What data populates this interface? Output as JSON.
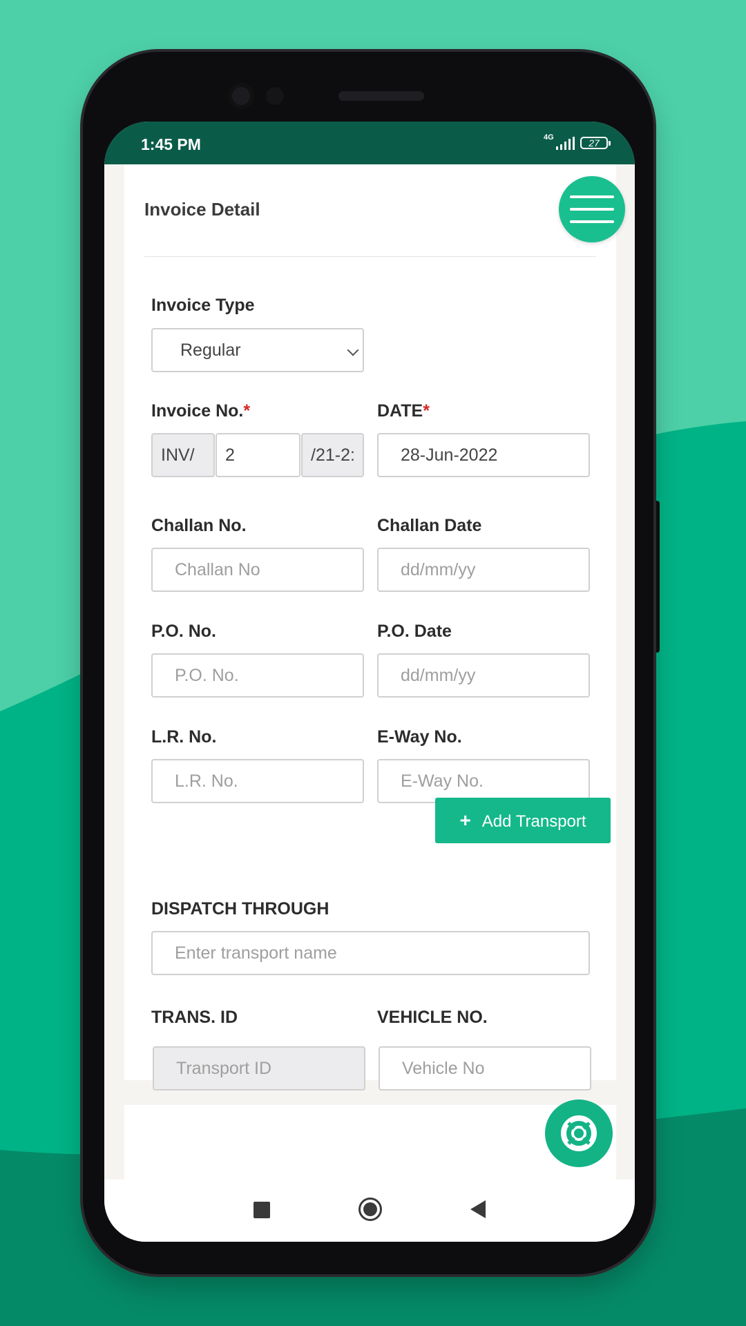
{
  "status_bar": {
    "time": "1:45 PM",
    "network": "4G",
    "battery": "27"
  },
  "colors": {
    "primary": "#14b88a",
    "status_bar": "#0a5c49",
    "required": "#d62828"
  },
  "page": {
    "title": "Invoice Detail",
    "menu_icon": "hamburger-menu-icon",
    "help_icon": "lifebuoy-icon"
  },
  "form": {
    "invoice_type": {
      "label": "Invoice Type",
      "value": "Regular"
    },
    "invoice_no": {
      "label": "Invoice No.",
      "required_mark": "*",
      "prefix": "INV/",
      "number": "2",
      "suffix": "/21-2:"
    },
    "date": {
      "label": "DATE",
      "required_mark": "*",
      "value": "28-Jun-2022"
    },
    "challan_no": {
      "label": "Challan No.",
      "placeholder": "Challan No"
    },
    "challan_date": {
      "label": "Challan Date",
      "placeholder": "dd/mm/yy"
    },
    "po_no": {
      "label": "P.O. No.",
      "placeholder": "P.O. No."
    },
    "po_date": {
      "label": "P.O. Date",
      "placeholder": "dd/mm/yy"
    },
    "lr_no": {
      "label": "L.R. No.",
      "placeholder": "L.R. No."
    },
    "eway_no": {
      "label": "E-Way No.",
      "placeholder": "E-Way No."
    },
    "add_transport": {
      "icon": "plus-icon",
      "label": "Add Transport"
    },
    "dispatch_through": {
      "label": "DISPATCH THROUGH",
      "placeholder": "Enter transport name"
    },
    "trans_id": {
      "label": "TRANS. ID",
      "placeholder": "Transport ID"
    },
    "vehicle_no": {
      "label": "VEHICLE NO.",
      "placeholder": "Vehicle No"
    }
  },
  "nav": {
    "recent_icon": "square-icon",
    "home_icon": "circle-icon",
    "back_icon": "triangle-back-icon"
  }
}
